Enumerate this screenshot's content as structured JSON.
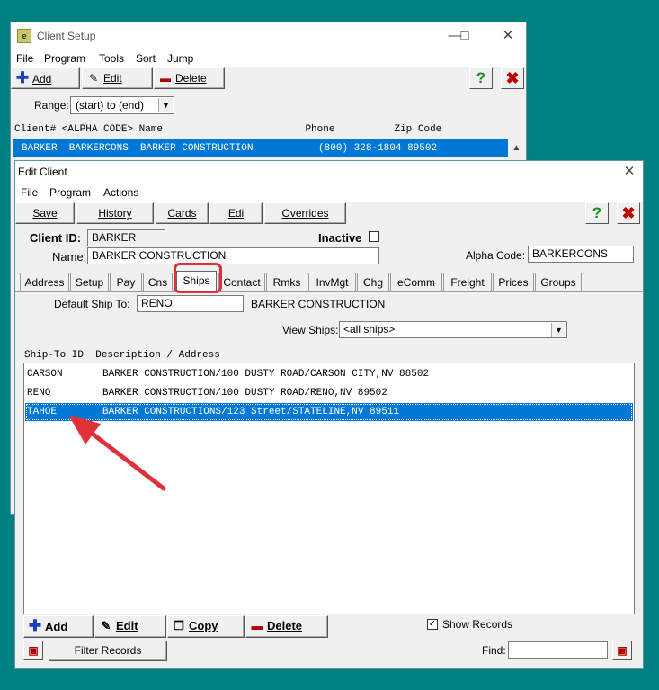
{
  "back_window": {
    "app_icon": "e",
    "title": "Client Setup",
    "menu": [
      "File",
      "Program",
      "Tools",
      "Sort",
      "Jump"
    ],
    "toolbar": {
      "add": "Add",
      "edit": "Edit",
      "delete": "Delete",
      "help_icon": "?"
    },
    "range_label": "Range:",
    "range_value": "(start) to (end)",
    "column_headers": "Client# <ALPHA CODE> Name                        Phone          Zip Code",
    "row": "BARKER  BARKERCONS  BARKER CONSTRUCTION           (800) 328-1804 89502"
  },
  "front_window": {
    "title": "Edit Client",
    "menu": [
      "File",
      "Program",
      "Actions"
    ],
    "toolbar": [
      "Save",
      "History",
      "Cards",
      "Edi",
      "Overrides"
    ],
    "help_icon": "?",
    "client_id_label": "Client ID:",
    "client_id": "BARKER",
    "inactive_label": "Inactive",
    "name_label": "Name:",
    "name": "BARKER CONSTRUCTION",
    "alpha_code_label": "Alpha Code:",
    "alpha_code": "BARKERCONS",
    "tabs": [
      "Address",
      "Setup",
      "Pay",
      "Cns",
      "Ships",
      "Contact",
      "Rmks",
      "InvMgt",
      "Chg",
      "eComm",
      "Freight",
      "Prices",
      "Groups"
    ],
    "active_tab": "Ships",
    "default_ship_label": "Default Ship To:",
    "default_ship_value": "RENO",
    "default_ship_desc": "BARKER CONSTRUCTION",
    "view_ships_label": "View Ships:",
    "view_ships_value": "<all ships>",
    "list_header": "Ship-To ID  Description / Address",
    "ships": [
      {
        "id": "CARSON",
        "desc": "BARKER CONSTRUCTION/100 DUSTY ROAD/CARSON CITY,NV 88502"
      },
      {
        "id": "RENO",
        "desc": "BARKER CONSTRUCTION/100 DUSTY ROAD/RENO,NV 89502"
      },
      {
        "id": "TAHOE",
        "desc": "BARKER CONSTRUCTIONS/123 Street/STATELINE,NV 89511"
      }
    ],
    "selected_ship": "TAHOE",
    "bottom_buttons": {
      "add": "Add",
      "edit": "Edit",
      "copy": "Copy",
      "delete": "Delete"
    },
    "show_records_label": "Show Records",
    "show_records_checked": true,
    "filter_records": "Filter Records",
    "find_label": "Find:",
    "find_value": ""
  },
  "annotation_color": "#e0313b"
}
